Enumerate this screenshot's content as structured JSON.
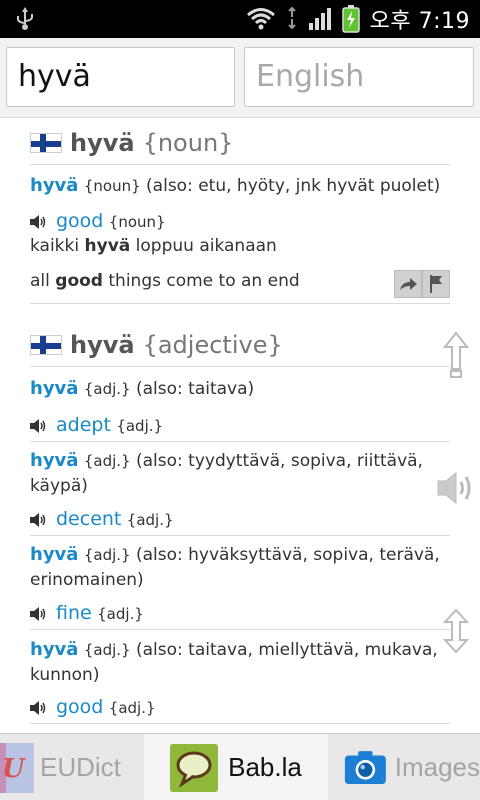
{
  "status_bar": {
    "time": "오후 7:19",
    "icons": [
      "usb-icon",
      "wifi-icon",
      "signal-icon",
      "battery-charging-icon"
    ]
  },
  "search": {
    "word": "hyvä",
    "language": "English"
  },
  "sections": {
    "noun": {
      "headword": "hyvä",
      "pos": "{noun}",
      "entry": {
        "word": "hyvä",
        "pos": "{noun}",
        "also": "(also: etu, hyöty, jnk hyvät puolet)"
      },
      "translation": {
        "word": "good",
        "pos": "{noun}"
      },
      "example_fi": {
        "before": "kaikki ",
        "bold": "hyvä",
        "after": " loppuu aikanaan"
      },
      "example_en": {
        "before": "all ",
        "bold": "good",
        "after": " things come to an end"
      }
    },
    "adjective": {
      "headword": "hyvä",
      "pos": "{adjective}",
      "entries": [
        {
          "word": "hyvä",
          "pos": "{adj.}",
          "also": "(also: taitava)",
          "translation": "adept",
          "tpos": "{adj.}"
        },
        {
          "word": "hyvä",
          "pos": "{adj.}",
          "also": "(also: tyydyttävä, sopiva, riittävä,",
          "also2": "käypä)",
          "translation": "decent",
          "tpos": "{adj.}"
        },
        {
          "word": "hyvä",
          "pos": "{adj.}",
          "also": "(also: hyväksyttävä, sopiva, terävä,",
          "also2": "erinomainen)",
          "translation": "fine",
          "tpos": "{adj.}"
        },
        {
          "word": "hyvä",
          "pos": "{adj.}",
          "also": "(also: taitava, miellyttävä, mukava,",
          "also2": "kunnon)",
          "translation": "good",
          "tpos": "{adj.}"
        }
      ]
    }
  },
  "bottom_tabs": [
    {
      "label": "EUDict",
      "icon": "eudict-logo-icon",
      "active": false
    },
    {
      "label": "Bab.la",
      "icon": "babla-logo-icon",
      "active": true
    },
    {
      "label": "Images",
      "icon": "camera-icon",
      "active": false
    }
  ],
  "colors": {
    "link": "#1a8ac6",
    "finland_blue": "#1a3e8f"
  }
}
